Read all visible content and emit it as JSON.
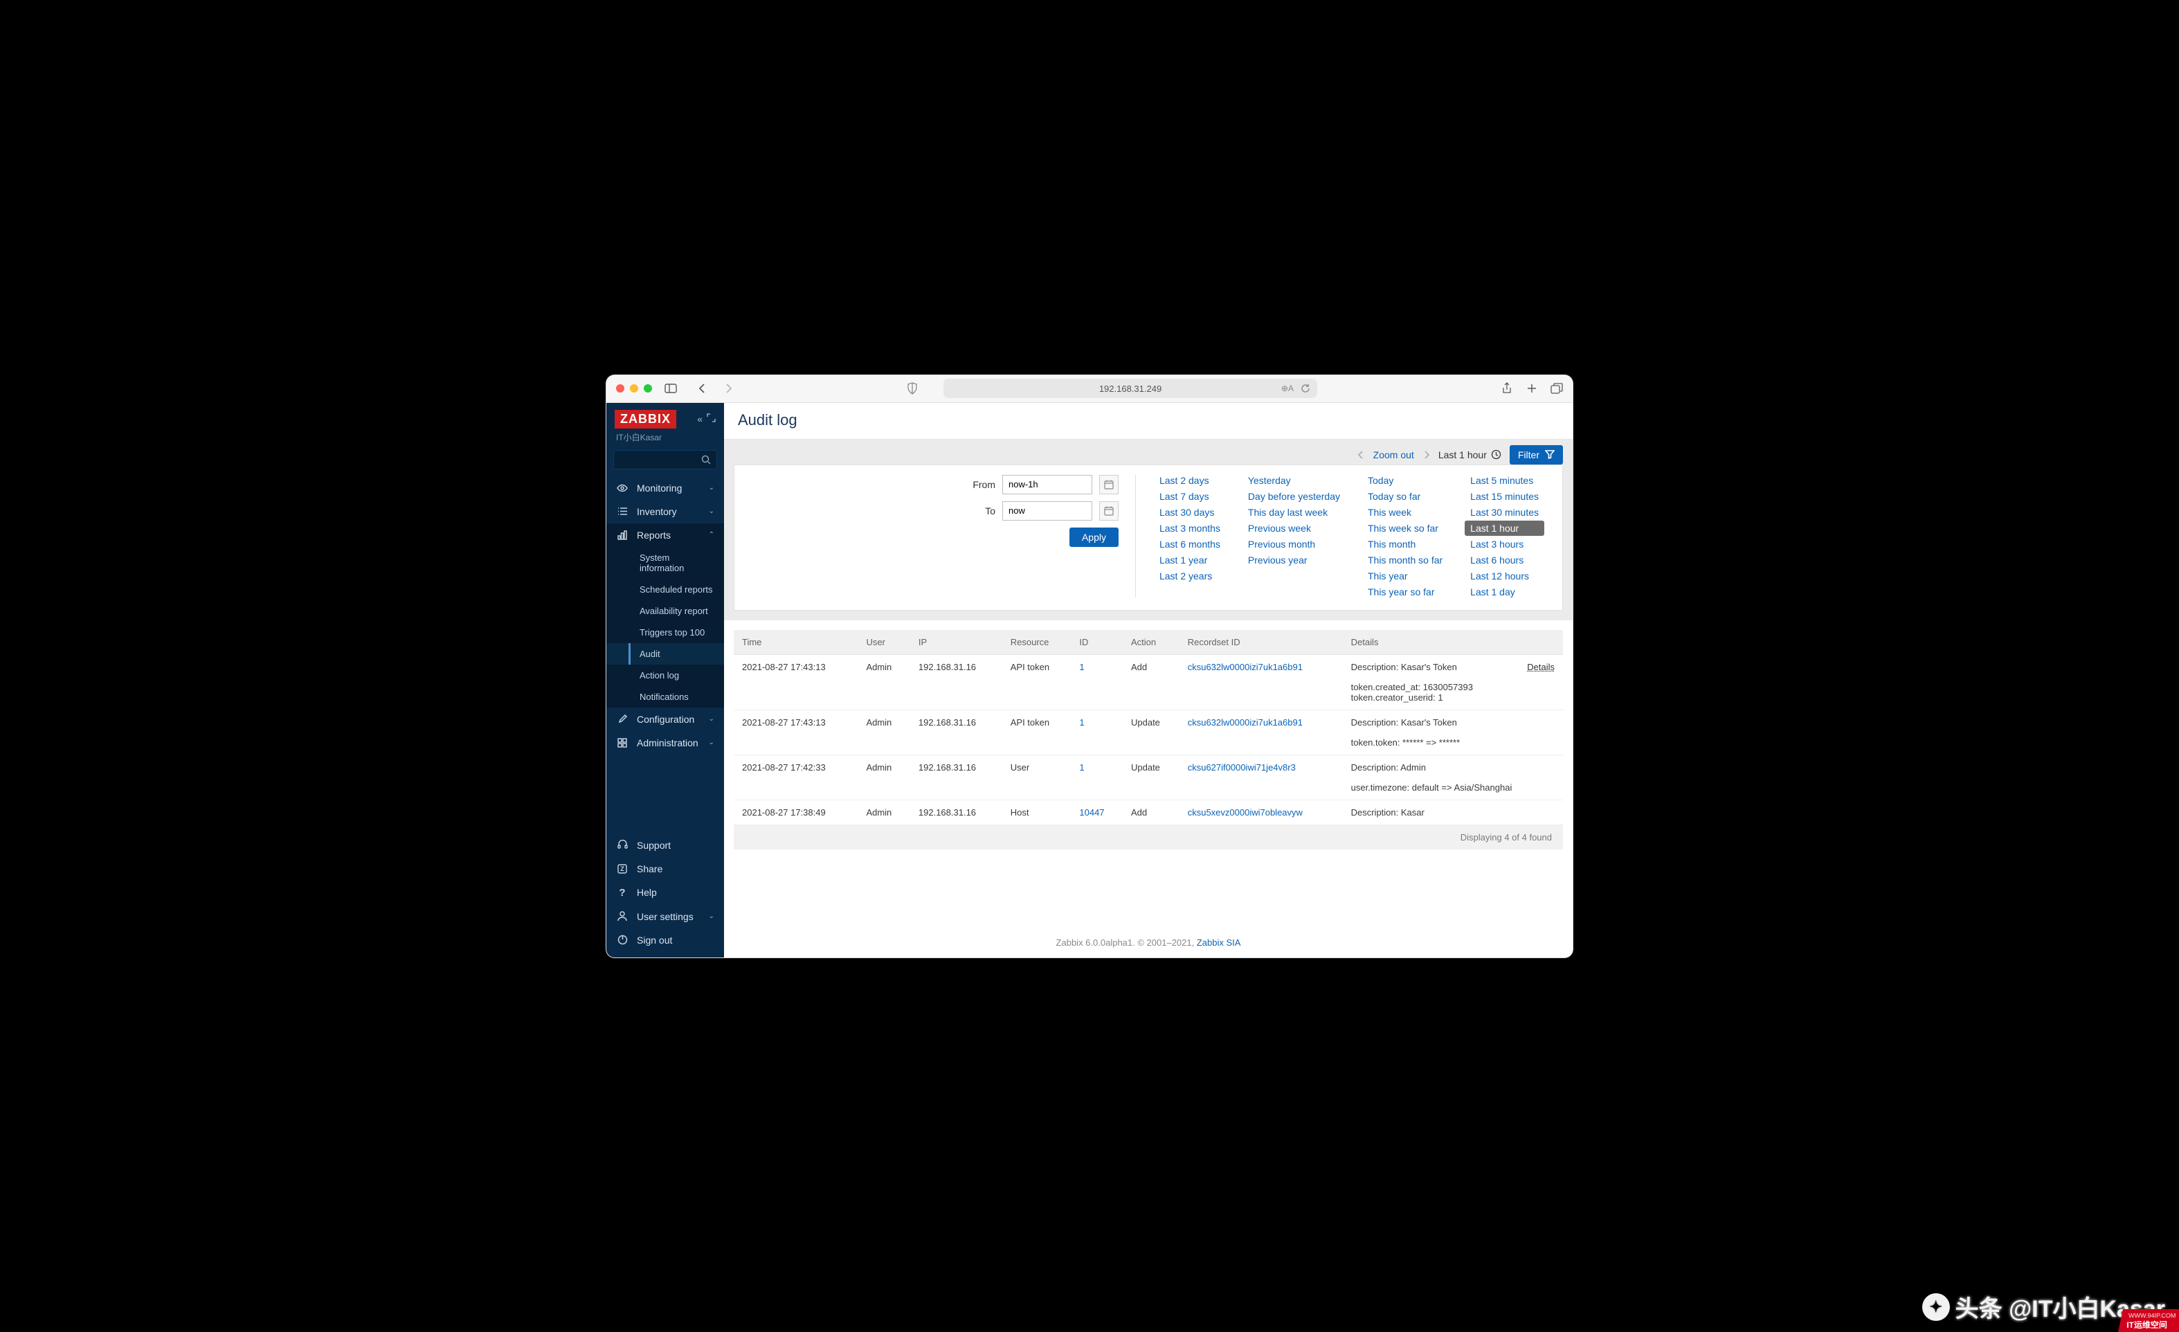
{
  "browser": {
    "url": "192.168.31.249"
  },
  "sidebar": {
    "logo": "ZABBIX",
    "server": "IT小白Kasar",
    "menu": {
      "monitoring": "Monitoring",
      "inventory": "Inventory",
      "reports": "Reports",
      "configuration": "Configuration",
      "administration": "Administration"
    },
    "reports_sub": {
      "system_information": "System information",
      "scheduled_reports": "Scheduled reports",
      "availability_report": "Availability report",
      "triggers_top_100": "Triggers top 100",
      "audit": "Audit",
      "action_log": "Action log",
      "notifications": "Notifications"
    },
    "bottom": {
      "support": "Support",
      "share": "Share",
      "help": "Help",
      "user_settings": "User settings",
      "sign_out": "Sign out"
    }
  },
  "page": {
    "title": "Audit log"
  },
  "toolbar": {
    "zoom_out": "Zoom out",
    "range_label": "Last 1 hour",
    "filter": "Filter"
  },
  "time_form": {
    "from_label": "From",
    "from_value": "now-1h",
    "to_label": "To",
    "to_value": "now",
    "apply": "Apply"
  },
  "quick": {
    "col1": [
      "Last 2 days",
      "Last 7 days",
      "Last 30 days",
      "Last 3 months",
      "Last 6 months",
      "Last 1 year",
      "Last 2 years"
    ],
    "col2": [
      "Yesterday",
      "Day before yesterday",
      "This day last week",
      "Previous week",
      "Previous month",
      "Previous year"
    ],
    "col3": [
      "Today",
      "Today so far",
      "This week",
      "This week so far",
      "This month",
      "This month so far",
      "This year",
      "This year so far"
    ],
    "col4": [
      "Last 5 minutes",
      "Last 15 minutes",
      "Last 30 minutes",
      "Last 1 hour",
      "Last 3 hours",
      "Last 6 hours",
      "Last 12 hours",
      "Last 1 day"
    ],
    "selected": "Last 1 hour"
  },
  "table": {
    "headers": {
      "time": "Time",
      "user": "User",
      "ip": "IP",
      "resource": "Resource",
      "id": "ID",
      "action": "Action",
      "recordset": "Recordset ID",
      "details": "Details"
    },
    "details_link": "Details",
    "rows": [
      {
        "time": "2021-08-27 17:43:13",
        "user": "Admin",
        "ip": "192.168.31.16",
        "resource": "API token",
        "id": "1",
        "action": "Add",
        "recordset": "cksu632lw0000izi7uk1a6b91",
        "details": "Description: Kasar's Token",
        "extra": "token.created_at: 1630057393\ntoken.creator_userid: 1",
        "has_link": true
      },
      {
        "time": "2021-08-27 17:43:13",
        "user": "Admin",
        "ip": "192.168.31.16",
        "resource": "API token",
        "id": "1",
        "action": "Update",
        "recordset": "cksu632lw0000izi7uk1a6b91",
        "details": "Description: Kasar's Token",
        "extra": "token.token: ****** => ******"
      },
      {
        "time": "2021-08-27 17:42:33",
        "user": "Admin",
        "ip": "192.168.31.16",
        "resource": "User",
        "id": "1",
        "action": "Update",
        "recordset": "cksu627if0000iwi71je4v8r3",
        "details": "Description: Admin",
        "extra": "user.timezone: default => Asia/Shanghai"
      },
      {
        "time": "2021-08-27 17:38:49",
        "user": "Admin",
        "ip": "192.168.31.16",
        "resource": "Host",
        "id": "10447",
        "action": "Add",
        "recordset": "cksu5xevz0000iwi7obleavyw",
        "details": "Description: Kasar"
      }
    ],
    "footer": "Displaying 4 of 4 found"
  },
  "footer": {
    "text_a": "Zabbix 6.0.0alpha1. © 2001–2021, ",
    "link": "Zabbix SIA"
  },
  "watermark": {
    "text": "头条 @IT小白Kasar",
    "badge_top": "WWW.94IP.COM",
    "badge": "IT运维空间"
  }
}
